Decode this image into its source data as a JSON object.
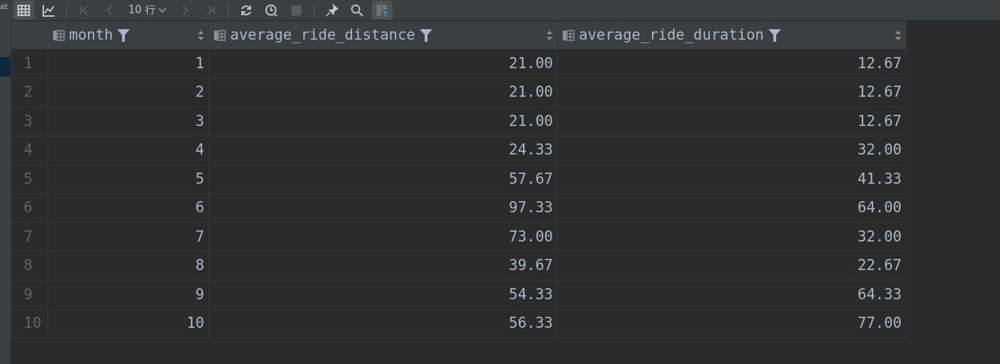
{
  "left_strip": {
    "text": "at"
  },
  "toolbar": [
    {
      "kind": "table",
      "selected": true,
      "disabled": false
    },
    {
      "kind": "chart",
      "selected": false,
      "disabled": false
    },
    {
      "kind": "sep"
    },
    {
      "kind": "first",
      "selected": false,
      "disabled": true
    },
    {
      "kind": "prev",
      "selected": false,
      "disabled": true
    },
    {
      "kind": "rows",
      "label": "10 行"
    },
    {
      "kind": "next",
      "selected": false,
      "disabled": true
    },
    {
      "kind": "last",
      "selected": false,
      "disabled": true
    },
    {
      "kind": "sep"
    },
    {
      "kind": "refresh",
      "selected": false,
      "disabled": false
    },
    {
      "kind": "history",
      "selected": false,
      "disabled": false
    },
    {
      "kind": "stop",
      "selected": false,
      "disabled": true
    },
    {
      "kind": "sep"
    },
    {
      "kind": "pin",
      "selected": false,
      "disabled": false
    },
    {
      "kind": "search",
      "selected": false,
      "disabled": false
    },
    {
      "kind": "filter",
      "selected": true,
      "disabled": false
    }
  ],
  "table": {
    "columns": [
      "month",
      "average_ride_distance",
      "average_ride_duration"
    ],
    "rows": [
      {
        "num": "1",
        "cells": [
          "1",
          "21.00",
          "12.67"
        ]
      },
      {
        "num": "2",
        "cells": [
          "2",
          "21.00",
          "12.67"
        ]
      },
      {
        "num": "3",
        "cells": [
          "3",
          "21.00",
          "12.67"
        ]
      },
      {
        "num": "4",
        "cells": [
          "4",
          "24.33",
          "32.00"
        ]
      },
      {
        "num": "5",
        "cells": [
          "5",
          "57.67",
          "41.33"
        ]
      },
      {
        "num": "6",
        "cells": [
          "6",
          "97.33",
          "64.00"
        ]
      },
      {
        "num": "7",
        "cells": [
          "7",
          "73.00",
          "32.00"
        ]
      },
      {
        "num": "8",
        "cells": [
          "8",
          "39.67",
          "22.67"
        ]
      },
      {
        "num": "9",
        "cells": [
          "9",
          "54.33",
          "64.33"
        ]
      },
      {
        "num": "10",
        "cells": [
          "10",
          "56.33",
          "77.00"
        ]
      }
    ]
  }
}
